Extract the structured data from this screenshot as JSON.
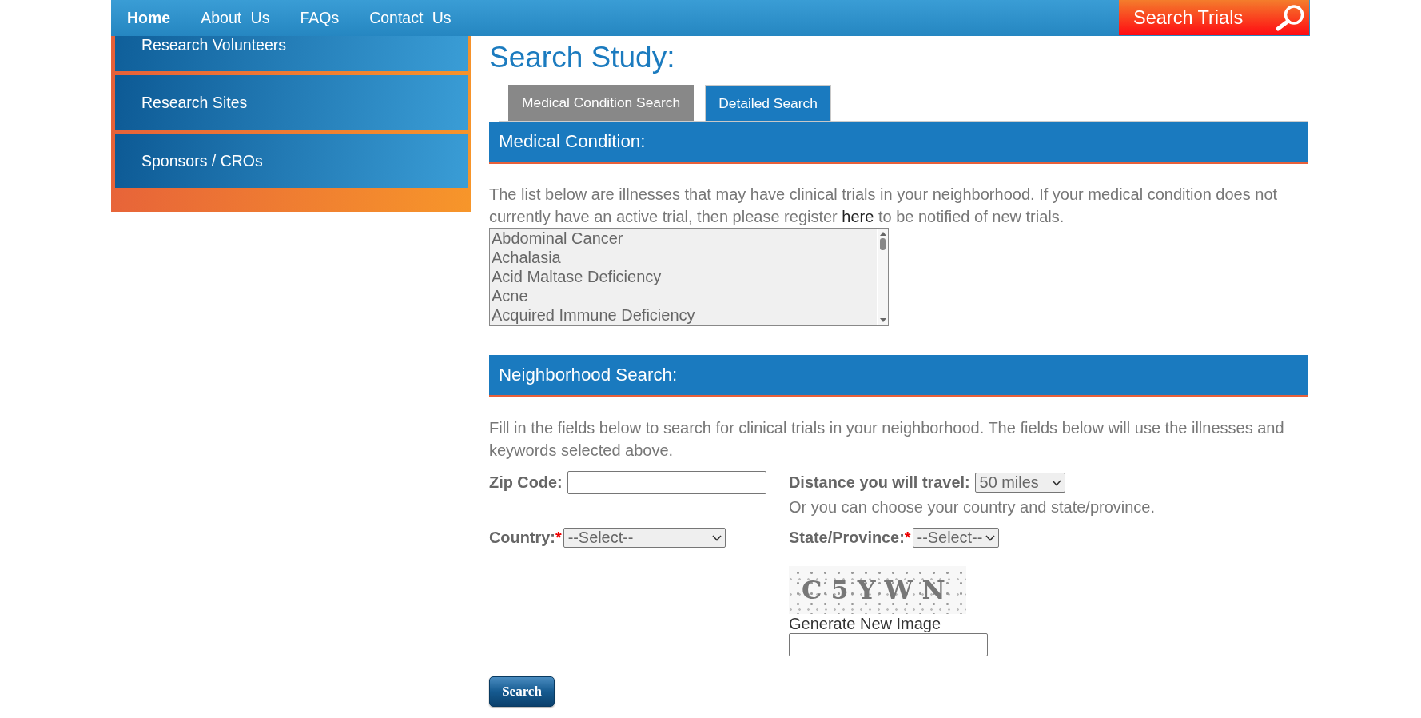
{
  "nav": {
    "links": [
      {
        "label": "Home",
        "selected": true
      },
      {
        "label": "About Us",
        "selected": false
      },
      {
        "label": "FAQs",
        "selected": false
      },
      {
        "label": "Contact Us",
        "selected": false
      }
    ],
    "search_button": "Search Trials"
  },
  "sidebar": {
    "items": [
      "Research Volunteers",
      "Research Sites",
      "Sponsors / CROs"
    ]
  },
  "page_title": "Search Study:",
  "tabs": [
    {
      "label": "Medical Condition Search",
      "selected": false
    },
    {
      "label": "Detailed Search",
      "selected": true
    }
  ],
  "medical_condition": {
    "heading": "Medical Condition:",
    "intro_before": "The list below are illnesses that may have clinical trials in your neighborhood. If your medical condition does not currently have an active trial, then please register",
    "intro_link": "here",
    "intro_after": "to be notified of new trials.",
    "conditions": [
      {
        "label": "Abdominal Cancer",
        "selected": false
      },
      {
        "label": "Achalasia",
        "selected": false
      },
      {
        "label": "Acid Maltase Deficiency",
        "selected": false
      },
      {
        "label": "Acne",
        "selected": false
      },
      {
        "label": "Acquired Immune Deficiency",
        "selected": false
      }
    ]
  },
  "neighborhood_search": {
    "heading": "Neighborhood Search:",
    "intro": "Fill in the fields below to search for clinical trials in your neighborhood. The fields below will use the illnesses and keywords selected above.",
    "zip_code": {
      "label": "Zip Code:"
    },
    "distance": {
      "label": "Distance you will travel:",
      "value": "50 miles"
    },
    "alternative_note": "Or you can choose your country and state/province.",
    "country": {
      "label": "Country:",
      "required_mark": "*",
      "value": "--Select--"
    },
    "state": {
      "label": "State/Province:",
      "required_mark": "*",
      "value": "--Select--"
    },
    "captcha": {
      "code": "C5YWN",
      "refresh_link": "Generate New Image"
    }
  },
  "search_button": "Search"
}
